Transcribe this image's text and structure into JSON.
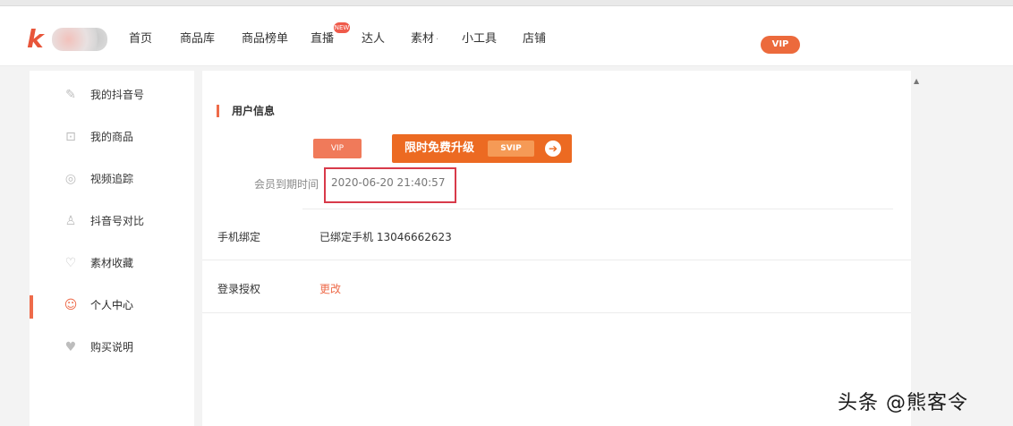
{
  "nav": {
    "logo_mark": "k",
    "items": [
      "首页",
      "商品库",
      "商品榜单",
      "直播",
      "达人",
      "素材",
      "小工具",
      "店铺"
    ],
    "material_caret": "·",
    "hot_badge": "NEW",
    "vip_label": "VIP"
  },
  "sidebar": {
    "items": [
      {
        "label": "我的抖音号",
        "icon": "✎"
      },
      {
        "label": "我的商品",
        "icon": "⊡"
      },
      {
        "label": "视频追踪",
        "icon": "◎"
      },
      {
        "label": "抖音号对比",
        "icon": "♙"
      },
      {
        "label": "素材收藏",
        "icon": "♡"
      },
      {
        "label": "个人中心",
        "icon": "☺"
      },
      {
        "label": "购买说明",
        "icon": "♥"
      }
    ],
    "active_index": 5
  },
  "main": {
    "section_title": "用户信息",
    "member_tag": "VIP",
    "upgrade_text": "限时免费升级",
    "upgrade_chip": "SVIP",
    "upgrade_arrow": "➔",
    "expire_label": "会员到期时间",
    "expire_value": "2020-06-20 21:40:57",
    "phone_label": "手机绑定",
    "phone_value": "已绑定手机 13046662623",
    "bind_label": "登录授权",
    "bind_action": "更改"
  },
  "scroll_mark": "▲",
  "watermark": "头条 @熊客令",
  "colors": {
    "accent": "#ee6b4a",
    "upgrade": "#ec6a22",
    "highlight_box": "#d83a4a"
  }
}
